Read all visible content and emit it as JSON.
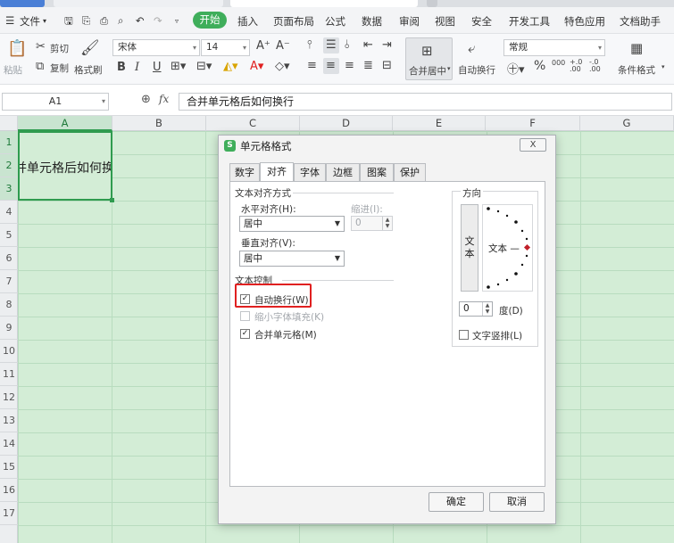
{
  "menu": {
    "file": "文件",
    "start": "开始",
    "insert": "插入",
    "page_layout": "页面布局",
    "formulas": "公式",
    "data": "数据",
    "review": "审阅",
    "view": "视图",
    "security": "安全",
    "dev_tools": "开发工具",
    "special_apps": "特色应用",
    "doc_assistant": "文档助手"
  },
  "ribbon": {
    "cut": "剪切",
    "copy": "复制",
    "format_painter": "格式刷",
    "paste": "粘贴",
    "font_name": "宋体",
    "font_size": "14",
    "merge_center": "合并居中",
    "wrap_text": "自动换行",
    "number_format": "常规",
    "conditional_format": "条件格式",
    "percent": "%",
    "thousands": "000",
    "dec_inc": "+.0 .00",
    "dec_dec": "-.0 .00"
  },
  "formula_bar": {
    "cell_ref": "A1",
    "fx": "fx",
    "content": "合并单元格后如何换行"
  },
  "sheet": {
    "columns": [
      "A",
      "B",
      "C",
      "D",
      "E",
      "F",
      "G"
    ],
    "rows": [
      "1",
      "2",
      "3",
      "4",
      "5",
      "6",
      "7",
      "8",
      "9",
      "10",
      "11",
      "12",
      "13",
      "14",
      "15",
      "16",
      "17"
    ],
    "cell_a1_text": "并单元格后如何换"
  },
  "dialog": {
    "title": "单元格格式",
    "close": "X",
    "tabs": [
      "数字",
      "对齐",
      "字体",
      "边框",
      "图案",
      "保护"
    ],
    "active_tab": "对齐",
    "text_alignment": {
      "section": "文本对齐方式",
      "horizontal_label": "水平对齐(H):",
      "horizontal_value": "居中",
      "indent_label": "缩进(I):",
      "indent_value": "0",
      "vertical_label": "垂直对齐(V):",
      "vertical_value": "居中"
    },
    "text_control": {
      "section": "文本控制",
      "wrap_text": "自动换行(W)",
      "wrap_checked": true,
      "shrink_to_fit": "缩小字体填充(K)",
      "shrink_checked": false,
      "merge_cells": "合并单元格(M)",
      "merge_checked": true
    },
    "orientation": {
      "section": "方向",
      "vertical_text": "文本",
      "dial_text": "文本 —",
      "degrees_value": "0",
      "degrees_label": "度(D)",
      "vertical_stack": "文字竖排(L)",
      "vertical_stack_checked": false
    },
    "ok": "确定",
    "cancel": "取消"
  },
  "colors": {
    "accent_green": "#3fae5b",
    "sheet_bg": "#d3edd6",
    "highlight_red": "#e02020"
  }
}
